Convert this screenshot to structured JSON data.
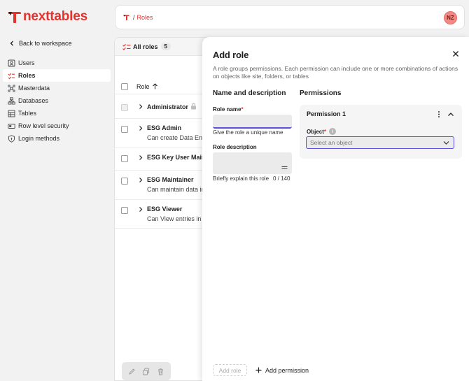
{
  "brand": {
    "name": "nexttables",
    "accent": "#e5322d",
    "focus": "#5b4fe0"
  },
  "sidebar": {
    "back_label": "Back to workspace",
    "items": [
      {
        "label": "Users",
        "icon": "user-id-icon",
        "active": false
      },
      {
        "label": "Roles",
        "icon": "roles-check-icon",
        "active": true
      },
      {
        "label": "Masterdata",
        "icon": "masterdata-icon",
        "active": false
      },
      {
        "label": "Databases",
        "icon": "databases-icon",
        "active": false
      },
      {
        "label": "Tables",
        "icon": "table-icon",
        "active": false
      },
      {
        "label": "Row level security",
        "icon": "row-security-icon",
        "active": false
      },
      {
        "label": "Login methods",
        "icon": "shield-icon",
        "active": false
      }
    ]
  },
  "header": {
    "breadcrumb_sep": "/",
    "breadcrumb": "Roles",
    "avatar_initials": "NZ"
  },
  "roles_list": {
    "title": "All roles",
    "count": "5",
    "column_role": "Role",
    "rows": [
      {
        "name": "Administrator",
        "desc": "",
        "locked": true
      },
      {
        "name": "ESG Admin",
        "desc": "Can create Data Entries"
      },
      {
        "name": "ESG Key User Maintainer",
        "desc": ""
      },
      {
        "name": "ESG Maintainer",
        "desc": "Can maintain data in ESG"
      },
      {
        "name": "ESG Viewer",
        "desc": "Can View entries in ESG"
      }
    ]
  },
  "drawer": {
    "title": "Add role",
    "description": "A role groups permissions. Each permission can include one or more combinations of actions on objects like site, folders, or tables",
    "section_name": "Name and description",
    "section_permissions": "Permissions",
    "role_name_label": "Role name",
    "required_mark": "*",
    "role_name_value": "",
    "role_name_help": "Give the role a unique name",
    "role_desc_label": "Role description",
    "role_desc_value": "",
    "role_desc_help": "Briefly explain this role",
    "char_count": "0 / 140",
    "permission_title": "Permission 1",
    "object_label": "Object",
    "object_info": "i",
    "object_placeholder": "Select an object",
    "add_role_label": "Add role",
    "add_permission_label": "Add permission"
  }
}
